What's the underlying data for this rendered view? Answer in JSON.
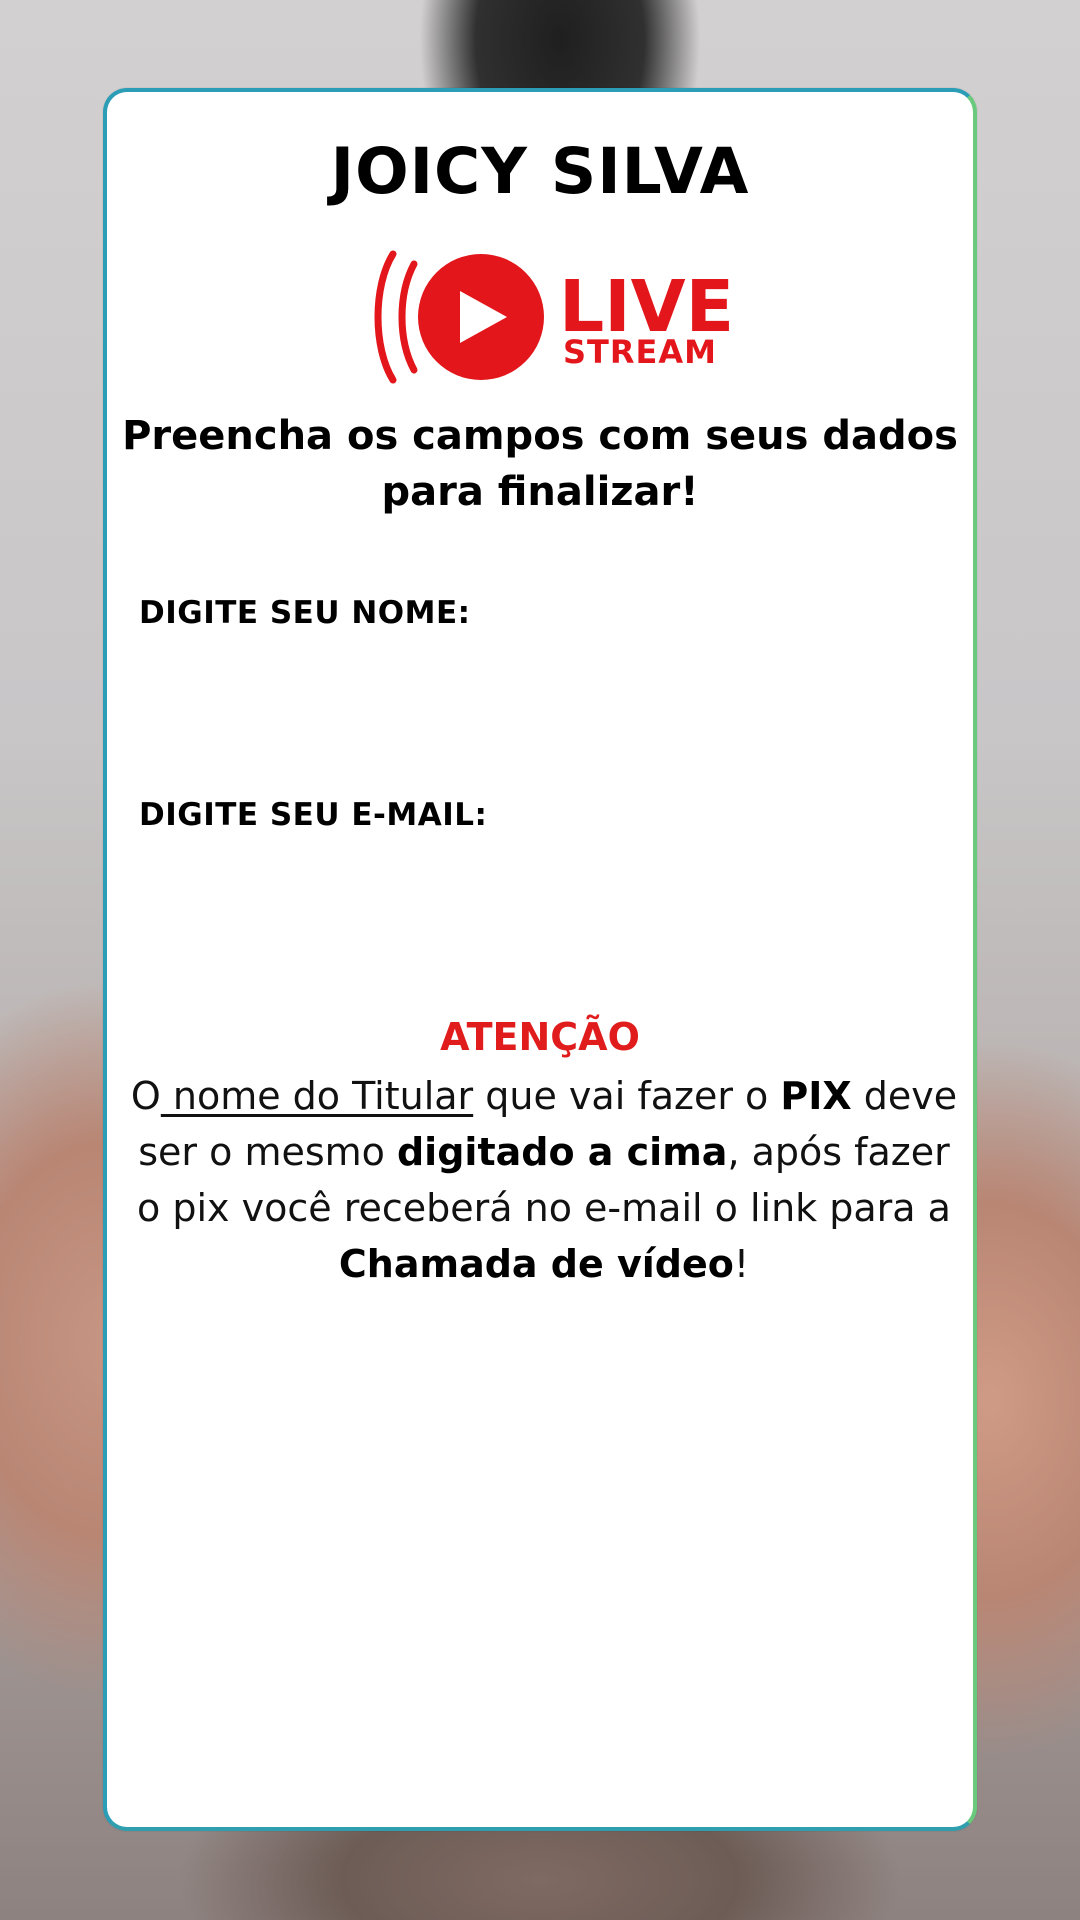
{
  "page": {
    "title": "JOICY SILVA",
    "instruction": "Preencha os campos com seus dados para finalizar!"
  },
  "logo": {
    "live_text": "LIVE",
    "stream_text": "STREAM",
    "icon_name": "play-icon",
    "signal_icon_name": "broadcast-icon",
    "accent_color": "#e3161b"
  },
  "form": {
    "name_label": "DIGITE SEU NOME:",
    "name_value": "",
    "email_label": "DIGITE SEU E-MAIL:",
    "email_value": ""
  },
  "attention": {
    "title": "ATENÇÃO",
    "text_1": "O",
    "text_2": " nome do Titular",
    "text_3": " que vai fazer o ",
    "text_4": "PIX",
    "text_5": " deve ser o mesmo ",
    "text_6": "digitado a cima",
    "text_7": ", após fazer o pix você receberá no e-mail o link para a ",
    "text_8": "Chamada de vídeo",
    "text_9": "!"
  },
  "colors": {
    "attention_red": "#e01c1c",
    "card_border": "#2b9db6",
    "card_border_alt": "#69c97d"
  }
}
